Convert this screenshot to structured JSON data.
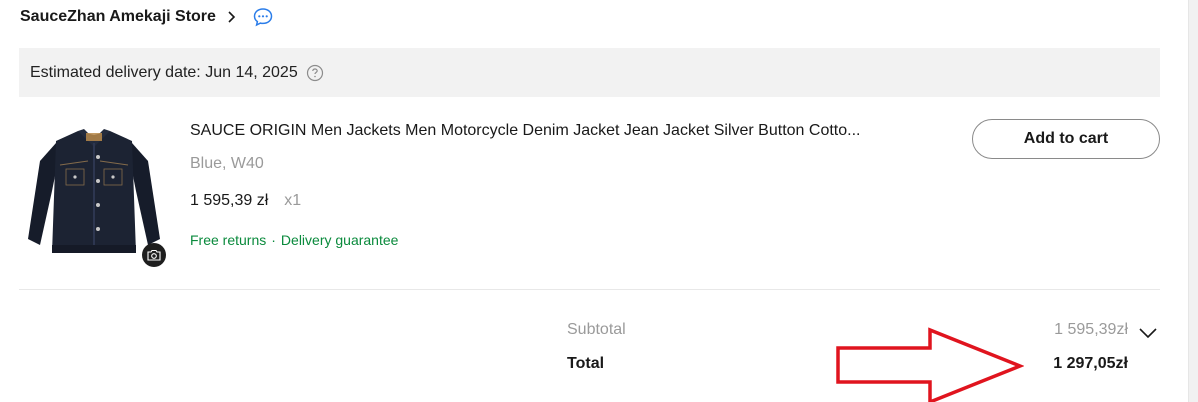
{
  "store": {
    "name": "SauceZhan Amekaji Store",
    "icons": {
      "chevron": "chevron-right-icon",
      "chat": "chat-bubble-icon"
    }
  },
  "delivery": {
    "text": "Estimated delivery date: Jun 14, 2025",
    "help_icon": "help-circle-icon"
  },
  "product": {
    "title": "SAUCE ORIGIN Men Jackets Men Motorcycle Denim Jacket Jean Jacket Silver Button Cotto...",
    "variant": "Blue, W40",
    "price": "1 595,39 zł",
    "quantity": "x1",
    "benefits": [
      "Free returns",
      "·",
      "Delivery guarantee"
    ],
    "add_to_cart_label": "Add to cart",
    "image_icon": "camera-icon"
  },
  "summary": {
    "subtotal_label": "Subtotal",
    "subtotal_value": "1 595,39zł",
    "total_label": "Total",
    "total_value": "1 297,05zł"
  },
  "colors": {
    "benefit_green": "#0a8a3c",
    "banner_bg": "#f2f2f2",
    "annotation_red": "#e0141e",
    "chat_blue": "#2b7de9"
  }
}
